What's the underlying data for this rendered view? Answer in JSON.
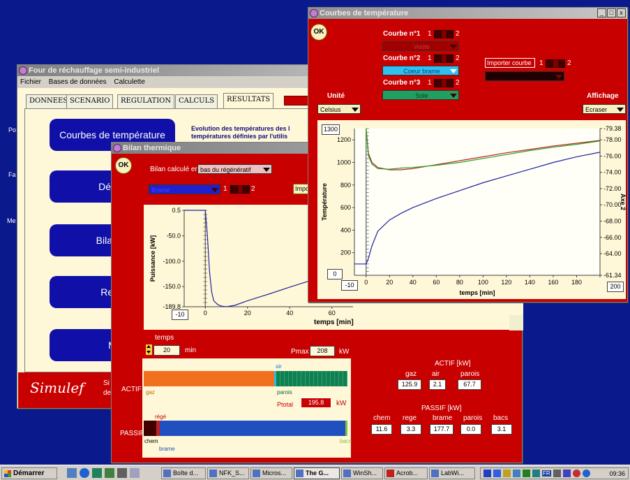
{
  "desktop": {
    "labels": [
      "Po",
      "Fa",
      "Me"
    ]
  },
  "main_window": {
    "title": "Four de réchauffage semi-industriel",
    "menu": [
      "Fichier",
      "Bases de données",
      "Calculette"
    ],
    "tabs": [
      "DONNEES",
      "SCENARIO",
      "REGULATION",
      "CALCULS",
      "RESULTATS"
    ],
    "nav_buttons": [
      "Courbes de température",
      "Débits",
      "Bilan th",
      "Rend",
      "M"
    ],
    "description": "Evolution des températures des l\ntempératures définies par l'utilis",
    "logo": "Simulef",
    "footer_text": [
      "Si",
      "de"
    ]
  },
  "bilan_window": {
    "title": "Bilan thermique",
    "ok": "OK",
    "bilan_label": "Bilan calculé en",
    "bilan_select": "bas du régénératif",
    "series_select": "Brame",
    "toggle_left": "1",
    "toggle_right": "2",
    "import_partial": "Impo",
    "temps_axis": "temps [min]",
    "temps_label": "temps",
    "temps_value": "20",
    "temps_unit": "min",
    "pmax_label": "Pmax",
    "pmax_value": "208",
    "pmax_unit": "kW",
    "actif_label": "ACTIF",
    "passif_label": "PASSIF",
    "bar_labels": {
      "gaz": "gaz",
      "air": "air",
      "parois": "parois",
      "rege": "régé",
      "chem": "chem",
      "brame": "brame",
      "bacs": "bacs"
    },
    "ptotal_label": "Ptotal",
    "ptotal_value": "195.8",
    "ptotal_unit": "kW",
    "actif_title": "ACTIF [kW]",
    "actif_headers": [
      "gaz",
      "air",
      "parois"
    ],
    "actif_values": [
      "125.9",
      "2.1",
      "67.7"
    ],
    "passif_title": "PASSIF [kW]",
    "passif_headers": [
      "chem",
      "rege",
      "brame",
      "parois",
      "bacs"
    ],
    "passif_values": [
      "11.6",
      "3.3",
      "177.7",
      "0.0",
      "3.1"
    ],
    "actif_fractions": {
      "gaz": 0.64,
      "air": 0.01,
      "parois": 0.35
    },
    "passif_fractions": {
      "chem": 0.06,
      "rege": 0.02,
      "brame": 0.91,
      "parois": 0.0,
      "bacs": 0.01
    }
  },
  "courbes_window": {
    "title": "Courbes de température",
    "ok": "OK",
    "courbe1_label": "Courbe n°1",
    "courbe1_select": "Voûte",
    "courbe2_label": "Courbe n°2",
    "courbe2_select": "Coeur brame",
    "courbe3_label": "Courbe n°3",
    "courbe3_select": "Sole",
    "toggle_left": "1",
    "toggle_right": "2",
    "import_label": "Importer courbe",
    "unite_label": "Unité",
    "unite_select": "Celsius",
    "affichage_label": "Affichage",
    "affichage_select": "Ecraser",
    "ymax_box": "1300",
    "ymin_box": "0",
    "xmin_box": "-10",
    "xmax_box": "200",
    "window_controls": [
      "_",
      "□",
      "x"
    ]
  },
  "bilan_chart": {
    "type": "line",
    "ylabel": "Puissance [kW]",
    "xlabel": "temps [min]",
    "ylim": [
      -189.8,
      0.5
    ],
    "xlim": [
      -10,
      70
    ],
    "x_ticks": [
      "-10",
      "0",
      "20",
      "40",
      "60"
    ],
    "y_ticks": [
      "0.5",
      "-50.0",
      "-100.0",
      "-150.0",
      "-189.8"
    ],
    "series": [
      {
        "color": "#2020a0",
        "x": [
          -10,
          0,
          1,
          2,
          3,
          4,
          6,
          8,
          10,
          14,
          20,
          30,
          40,
          50,
          60,
          70
        ],
        "y": [
          0.5,
          0.5,
          -50,
          -120,
          -160,
          -178,
          -186,
          -189,
          -189.8,
          -187,
          -178,
          -165,
          -151,
          -138,
          -127,
          -117
        ]
      }
    ]
  },
  "temp_chart": {
    "type": "line",
    "ylabel": "Température",
    "y2label": "Axe 2",
    "xlabel": "temps [min]",
    "xlim": [
      -10,
      200
    ],
    "ylim": [
      0,
      1300
    ],
    "y2lim": [
      -61.34,
      -79.38
    ],
    "x_ticks": [
      "0",
      "20",
      "40",
      "60",
      "80",
      "100",
      "120",
      "140",
      "160",
      "180",
      "200"
    ],
    "y_ticks": [
      "200",
      "400",
      "600",
      "800",
      "1000",
      "1200"
    ],
    "y2_ticks": [
      "-79.38",
      "-78.00",
      "-76.00",
      "-74.00",
      "-72.00",
      "-70.00",
      "-68.00",
      "-66.00",
      "-64.00",
      "-61.34"
    ],
    "series": [
      {
        "color": "#c02020",
        "x": [
          0,
          2,
          5,
          10,
          20,
          30,
          40,
          60,
          80,
          100,
          120,
          140,
          160,
          180,
          200
        ],
        "y": [
          1300,
          1080,
          1000,
          955,
          935,
          935,
          945,
          980,
          1015,
          1050,
          1085,
          1115,
          1145,
          1170,
          1195
        ]
      },
      {
        "color": "#20a020",
        "x": [
          0,
          2,
          5,
          10,
          20,
          30,
          40,
          60,
          80,
          100,
          120,
          140,
          160,
          180,
          200
        ],
        "y": [
          1300,
          1060,
          985,
          945,
          940,
          950,
          955,
          975,
          1000,
          1035,
          1070,
          1105,
          1135,
          1160,
          1190
        ]
      },
      {
        "color": "#2020a0",
        "x": [
          -10,
          0,
          2,
          5,
          10,
          20,
          30,
          40,
          60,
          80,
          100,
          120,
          140,
          160,
          180,
          200
        ],
        "y": [
          100,
          100,
          150,
          260,
          390,
          490,
          550,
          600,
          680,
          750,
          820,
          880,
          940,
          1000,
          1050,
          1090
        ]
      }
    ]
  },
  "taskbar": {
    "start": "Démarrer",
    "items": [
      "Boîte d...",
      "NFK_S...",
      "Micros...",
      "The G...",
      "WinSh...",
      "Acrob...",
      "LabWi..."
    ],
    "clock": "09:36",
    "lang": "FR"
  }
}
